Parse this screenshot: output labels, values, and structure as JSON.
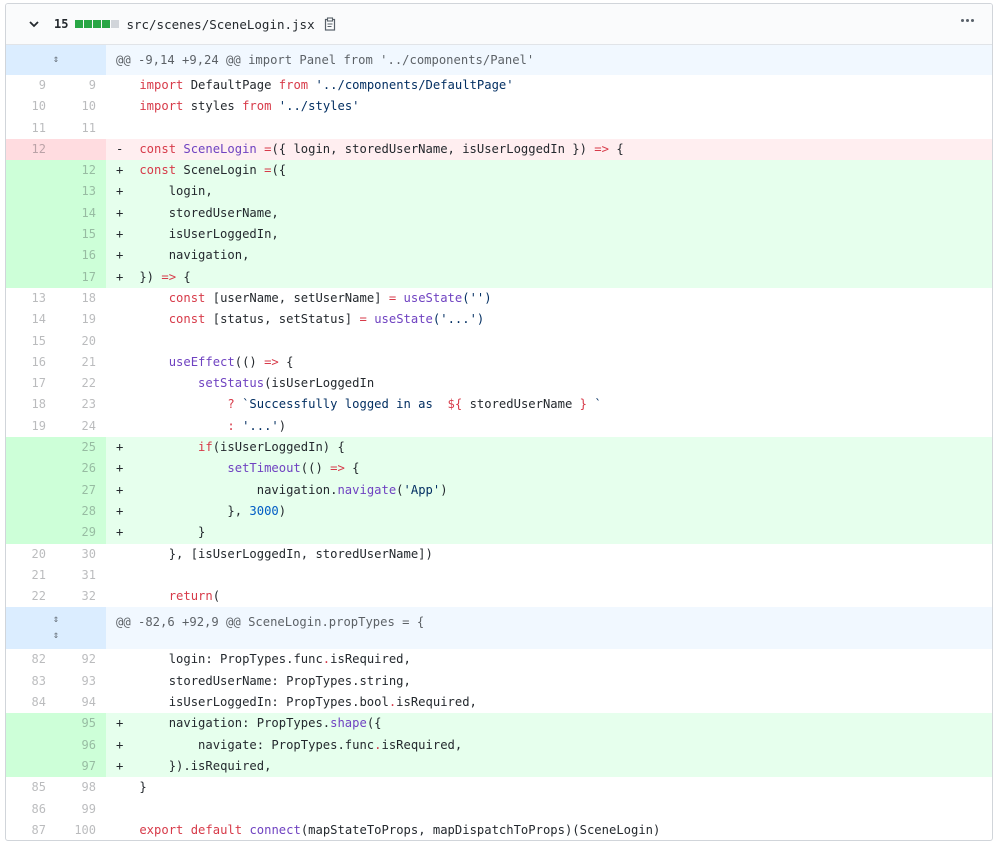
{
  "file": {
    "changes": "15",
    "path": "src/scenes/SceneLogin.jsx",
    "diffstat": [
      "#28a745",
      "#28a745",
      "#28a745",
      "#28a745",
      "#d1d5da"
    ],
    "icons": {
      "collapse": "chevron-down-icon",
      "copy": "clipboard-icon",
      "more": "kebab-icon",
      "expand": "unfold-icon"
    }
  },
  "rows": [
    {
      "kind": "hunk",
      "text": "@@ -9,14 +9,24 @@ import Panel from '../components/Panel'"
    },
    {
      "kind": "ctx",
      "o": "9",
      "n": "9",
      "marker": " ",
      "code": [
        [
          "k",
          "import"
        ],
        [
          "",
          "DefaultPage"
        ],
        [
          "k",
          "from"
        ],
        [
          "s",
          "'../components/DefaultPage'"
        ]
      ]
    },
    {
      "kind": "ctx",
      "o": "10",
      "n": "10",
      "marker": " ",
      "code": [
        [
          "k",
          "import"
        ],
        [
          "",
          "styles"
        ],
        [
          "k",
          "from"
        ],
        [
          "s",
          "'../styles'"
        ]
      ]
    },
    {
      "kind": "ctx",
      "o": "11",
      "n": "11",
      "marker": " ",
      "code": []
    },
    {
      "kind": "del",
      "o": "12",
      "n": "",
      "marker": "-",
      "code": [
        [
          "k",
          "const"
        ],
        [
          "f",
          "SceneLogin"
        ],
        [
          "k",
          "="
        ],
        [
          "",
          "({ login, storedUserName, isUserLoggedIn })"
        ],
        [
          "k",
          "=>"
        ],
        [
          "",
          "{"
        ]
      ]
    },
    {
      "kind": "add",
      "o": "",
      "n": "12",
      "marker": "+",
      "code": [
        [
          "k",
          "const"
        ],
        [
          "",
          "SceneLogin"
        ],
        [
          "k",
          "="
        ],
        [
          "",
          "({"
        ]
      ]
    },
    {
      "kind": "add",
      "o": "",
      "n": "13",
      "marker": "+",
      "code": [
        [
          "",
          "    login,"
        ]
      ]
    },
    {
      "kind": "add",
      "o": "",
      "n": "14",
      "marker": "+",
      "code": [
        [
          "",
          "    storedUserName,"
        ]
      ]
    },
    {
      "kind": "add",
      "o": "",
      "n": "15",
      "marker": "+",
      "code": [
        [
          "",
          "    isUserLoggedIn,"
        ]
      ]
    },
    {
      "kind": "add",
      "o": "",
      "n": "16",
      "marker": "+",
      "code": [
        [
          "",
          "    navigation,"
        ]
      ]
    },
    {
      "kind": "add",
      "o": "",
      "n": "17",
      "marker": "+",
      "code": [
        [
          "",
          "})"
        ],
        [
          "k",
          "=>"
        ],
        [
          "",
          "{"
        ]
      ]
    },
    {
      "kind": "ctx",
      "o": "13",
      "n": "18",
      "marker": " ",
      "code": [
        [
          "k",
          "    const"
        ],
        [
          "",
          "[userName, setUserName]"
        ],
        [
          "k",
          "="
        ],
        [
          "f",
          "useState"
        ],
        [
          "s",
          "('')"
        ]
      ]
    },
    {
      "kind": "ctx",
      "o": "14",
      "n": "19",
      "marker": " ",
      "code": [
        [
          "k",
          "    const"
        ],
        [
          "",
          "[status, setStatus]"
        ],
        [
          "k",
          "="
        ],
        [
          "f",
          "useState"
        ],
        [
          "s",
          "('...')"
        ]
      ]
    },
    {
      "kind": "ctx",
      "o": "15",
      "n": "20",
      "marker": " ",
      "code": []
    },
    {
      "kind": "ctx",
      "o": "16",
      "n": "21",
      "marker": " ",
      "code": [
        [
          "f",
          "    useEffect"
        ],
        [
          "",
          "(()"
        ],
        [
          "k",
          "=>"
        ],
        [
          "",
          "{"
        ]
      ]
    },
    {
      "kind": "ctx",
      "o": "17",
      "n": "22",
      "marker": " ",
      "code": [
        [
          "f",
          "        setStatus"
        ],
        [
          "",
          "(isUserLoggedIn"
        ]
      ]
    },
    {
      "kind": "ctx",
      "o": "18",
      "n": "23",
      "marker": " ",
      "code": [
        [
          "k",
          "            ?"
        ],
        [
          "s",
          "`Successfully logged in as "
        ],
        [
          "k",
          "${"
        ],
        [
          "",
          "storedUserName"
        ],
        [
          "k",
          "}"
        ],
        [
          "s",
          "`"
        ]
      ]
    },
    {
      "kind": "ctx",
      "o": "19",
      "n": "24",
      "marker": " ",
      "code": [
        [
          "k",
          "            :"
        ],
        [
          "s",
          "'...'"
        ],
        [
          "",
          ")"
        ]
      ]
    },
    {
      "kind": "add",
      "o": "",
      "n": "25",
      "marker": "+",
      "code": [
        [
          "k",
          "        if"
        ],
        [
          "",
          "(isUserLoggedIn) {"
        ]
      ]
    },
    {
      "kind": "add",
      "o": "",
      "n": "26",
      "marker": "+",
      "code": [
        [
          "f",
          "            setTimeout"
        ],
        [
          "",
          "(()"
        ],
        [
          "k",
          "=>"
        ],
        [
          "",
          "{"
        ]
      ]
    },
    {
      "kind": "add",
      "o": "",
      "n": "27",
      "marker": "+",
      "code": [
        [
          "",
          "                navigation."
        ],
        [
          "f",
          "navigate"
        ],
        [
          "",
          "("
        ],
        [
          "s",
          "'App'"
        ],
        [
          "",
          ")"
        ]
      ]
    },
    {
      "kind": "add",
      "o": "",
      "n": "28",
      "marker": "+",
      "code": [
        [
          "",
          "            },"
        ],
        [
          "n",
          "3000"
        ],
        [
          "",
          ")"
        ]
      ]
    },
    {
      "kind": "add",
      "o": "",
      "n": "29",
      "marker": "+",
      "code": [
        [
          "",
          "        }"
        ]
      ]
    },
    {
      "kind": "ctx",
      "o": "20",
      "n": "30",
      "marker": " ",
      "code": [
        [
          "",
          "    }, [isUserLoggedIn, storedUserName])"
        ]
      ]
    },
    {
      "kind": "ctx",
      "o": "21",
      "n": "31",
      "marker": " ",
      "code": []
    },
    {
      "kind": "ctx",
      "o": "22",
      "n": "32",
      "marker": " ",
      "code": [
        [
          "k",
          "    return"
        ],
        [
          "",
          "("
        ]
      ]
    },
    {
      "kind": "hunk2",
      "text": "@@ -82,6 +92,9 @@ SceneLogin.propTypes = {"
    },
    {
      "kind": "ctx",
      "o": "82",
      "n": "92",
      "marker": " ",
      "code": [
        [
          "",
          "    login: PropTypes."
        ],
        [
          "",
          "func"
        ],
        [
          "k",
          "."
        ],
        [
          "",
          "isRequired,"
        ]
      ]
    },
    {
      "kind": "ctx",
      "o": "83",
      "n": "93",
      "marker": " ",
      "code": [
        [
          "",
          "    storedUserName: PropTypes."
        ],
        [
          "",
          "string,"
        ]
      ]
    },
    {
      "kind": "ctx",
      "o": "84",
      "n": "94",
      "marker": " ",
      "code": [
        [
          "",
          "    isUserLoggedIn: PropTypes."
        ],
        [
          "",
          "bool"
        ],
        [
          "k",
          "."
        ],
        [
          "",
          "isRequired,"
        ]
      ]
    },
    {
      "kind": "add",
      "o": "",
      "n": "95",
      "marker": "+",
      "code": [
        [
          "",
          "    navigation: PropTypes."
        ],
        [
          "f",
          "shape"
        ],
        [
          "",
          "({"
        ]
      ]
    },
    {
      "kind": "add",
      "o": "",
      "n": "96",
      "marker": "+",
      "code": [
        [
          "",
          "        navigate: PropTypes."
        ],
        [
          "",
          "func"
        ],
        [
          "k",
          "."
        ],
        [
          "",
          "isRequired,"
        ]
      ]
    },
    {
      "kind": "add",
      "o": "",
      "n": "97",
      "marker": "+",
      "code": [
        [
          "",
          "    })."
        ],
        [
          "",
          "isRequired,"
        ]
      ]
    },
    {
      "kind": "ctx",
      "o": "85",
      "n": "98",
      "marker": " ",
      "code": [
        [
          "",
          "}"
        ]
      ]
    },
    {
      "kind": "ctx",
      "o": "86",
      "n": "99",
      "marker": " ",
      "code": []
    },
    {
      "kind": "ctx",
      "o": "87",
      "n": "100",
      "marker": " ",
      "code": [
        [
          "k",
          "export"
        ],
        [
          "k",
          "default"
        ],
        [
          "f",
          "connect"
        ],
        [
          "",
          "(mapStateToProps, mapDispatchToProps)(SceneLogin)"
        ]
      ]
    }
  ]
}
